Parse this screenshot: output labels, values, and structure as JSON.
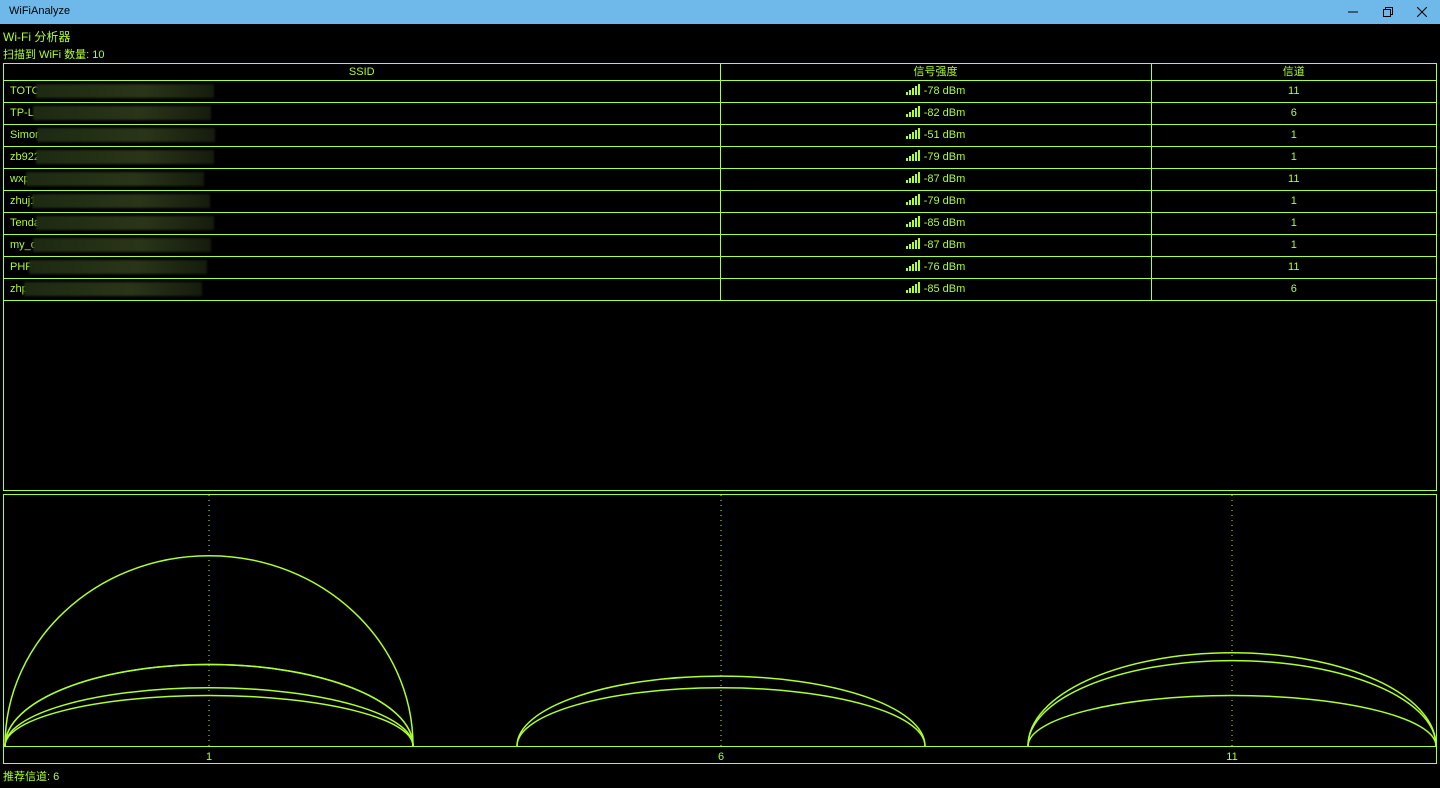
{
  "window": {
    "title": "WiFiAnalyze",
    "minimize_icon": "minimize-icon",
    "maximize_icon": "restore-icon",
    "close_icon": "close-icon"
  },
  "header": {
    "app_title": "Wi-Fi 分析器",
    "scan_count": "扫描到 WiFi 数量: 10"
  },
  "table": {
    "columns": [
      "SSID",
      "信号强度",
      "信道"
    ],
    "rows": [
      {
        "ssid": "TOTO",
        "signal": "-78 dBm",
        "channel": "11"
      },
      {
        "ssid": "TP-LI",
        "signal": "-82 dBm",
        "channel": "6"
      },
      {
        "ssid": "Simon",
        "signal": "-51 dBm",
        "channel": "1"
      },
      {
        "ssid": "zb922",
        "signal": "-79 dBm",
        "channel": "1"
      },
      {
        "ssid": "wxp",
        "signal": "-87 dBm",
        "channel": "11"
      },
      {
        "ssid": "zhuj1",
        "signal": "-79 dBm",
        "channel": "1"
      },
      {
        "ssid": "Tenda",
        "signal": "-85 dBm",
        "channel": "1"
      },
      {
        "ssid": "my_d",
        "signal": "-87 dBm",
        "channel": "1"
      },
      {
        "ssid": "PHP",
        "signal": "-76 dBm",
        "channel": "11"
      },
      {
        "ssid": "zhp",
        "signal": "-85 dBm",
        "channel": "6"
      }
    ]
  },
  "chart_data": {
    "type": "area",
    "channels": [
      "1",
      "6",
      "11"
    ],
    "ylim": [
      -100,
      -40
    ],
    "series": [
      {
        "channel": 1,
        "rssi": -51
      },
      {
        "channel": 1,
        "rssi": -79
      },
      {
        "channel": 1,
        "rssi": -79
      },
      {
        "channel": 1,
        "rssi": -85
      },
      {
        "channel": 1,
        "rssi": -87
      },
      {
        "channel": 6,
        "rssi": -82
      },
      {
        "channel": 6,
        "rssi": -85
      },
      {
        "channel": 11,
        "rssi": -76
      },
      {
        "channel": 11,
        "rssi": -78
      },
      {
        "channel": 11,
        "rssi": -87
      }
    ]
  },
  "footer": {
    "recommend": "推荐信道: 6"
  },
  "colors": {
    "accent": "#adff2f",
    "background": "#000000",
    "titlebar": "#6fb8ea"
  }
}
